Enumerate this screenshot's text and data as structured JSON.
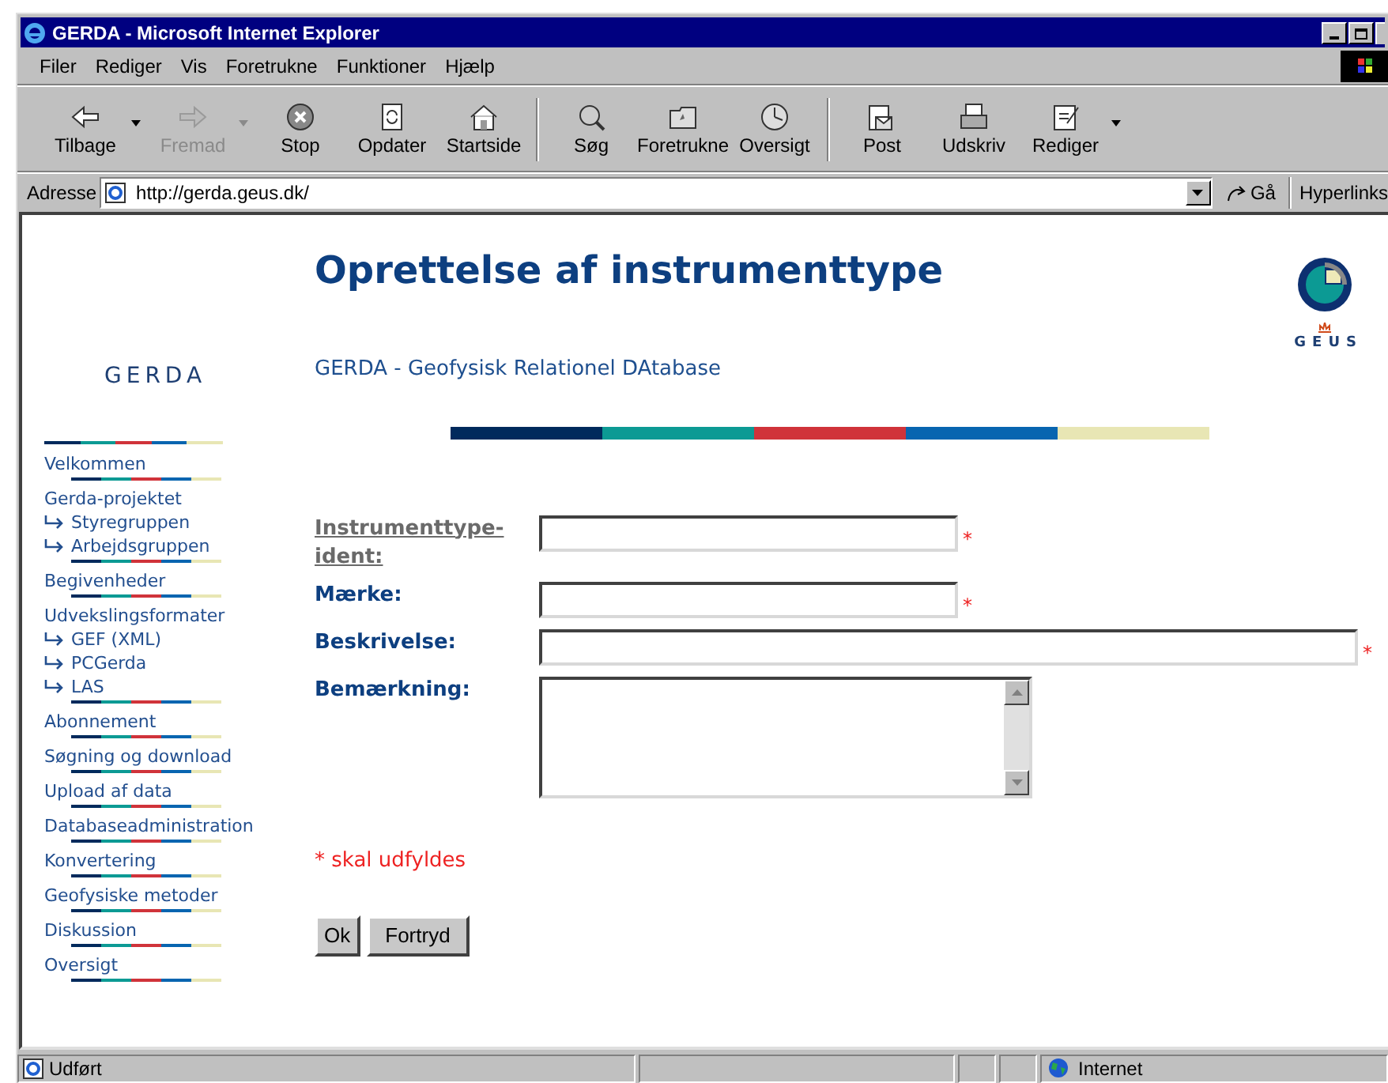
{
  "window": {
    "title": "GERDA - Microsoft Internet Explorer"
  },
  "menu": [
    "Filer",
    "Rediger",
    "Vis",
    "Foretrukne",
    "Funktioner",
    "Hjælp"
  ],
  "toolbar": [
    {
      "label": "Tilbage",
      "kind": "back",
      "disabled": false,
      "dropdown": true
    },
    {
      "label": "Fremad",
      "kind": "forward",
      "disabled": true,
      "dropdown": true
    },
    {
      "label": "Stop",
      "kind": "stop",
      "disabled": false,
      "dropdown": false
    },
    {
      "label": "Opdater",
      "kind": "refresh",
      "disabled": false,
      "dropdown": false
    },
    {
      "label": "Startside",
      "kind": "home",
      "disabled": false,
      "dropdown": false
    },
    {
      "label": "Søg",
      "kind": "search",
      "disabled": false,
      "dropdown": false
    },
    {
      "label": "Foretrukne",
      "kind": "favorites",
      "disabled": false,
      "dropdown": false
    },
    {
      "label": "Oversigt",
      "kind": "history",
      "disabled": false,
      "dropdown": false
    },
    {
      "label": "Post",
      "kind": "mail",
      "disabled": false,
      "dropdown": false
    },
    {
      "label": "Udskriv",
      "kind": "print",
      "disabled": false,
      "dropdown": false
    },
    {
      "label": "Rediger",
      "kind": "edit",
      "disabled": false,
      "dropdown": true
    }
  ],
  "address_bar": {
    "label": "Adresse",
    "value": "http://gerda.geus.dk/",
    "go": "Gå",
    "links": "Hyperlinks"
  },
  "sidebar": {
    "logo": "GERDA",
    "items": [
      {
        "label": "Velkommen"
      },
      {
        "label": "Gerda-projektet",
        "children": [
          {
            "label": "Styregruppen"
          },
          {
            "label": "Arbejdsgruppen"
          }
        ]
      },
      {
        "label": "Begivenheder"
      },
      {
        "label": "Udvekslingsformater",
        "children": [
          {
            "label": "GEF (XML)"
          },
          {
            "label": "PCGerda"
          },
          {
            "label": "LAS"
          }
        ]
      },
      {
        "label": "Abonnement"
      },
      {
        "label": "Søgning og download"
      },
      {
        "label": "Upload af data"
      },
      {
        "label": "Databaseadministration"
      },
      {
        "label": "Konvertering"
      },
      {
        "label": "Geofysiske metoder"
      },
      {
        "label": "Diskussion"
      },
      {
        "label": "Oversigt"
      }
    ]
  },
  "page": {
    "title": "Oprettelse af instrumenttype",
    "subtitle": "GERDA - Geofysisk Relationel DAtabase",
    "logo_text": "GEUS"
  },
  "form": {
    "fields": [
      {
        "label": "Instrumenttype-ident:",
        "link": true,
        "kind": "short",
        "required_mark": "*"
      },
      {
        "label": "Mærke:",
        "link": false,
        "kind": "short",
        "required_mark": "*"
      },
      {
        "label": "Beskrivelse:",
        "link": false,
        "kind": "wide",
        "required_mark": "*"
      },
      {
        "label": "Bemærkning:",
        "link": false,
        "kind": "textarea"
      }
    ],
    "note": "* skal udfyldes",
    "buttons": [
      "Ok",
      "Fortryd"
    ]
  },
  "status_bar": {
    "text": "Udført",
    "zone": "Internet"
  }
}
